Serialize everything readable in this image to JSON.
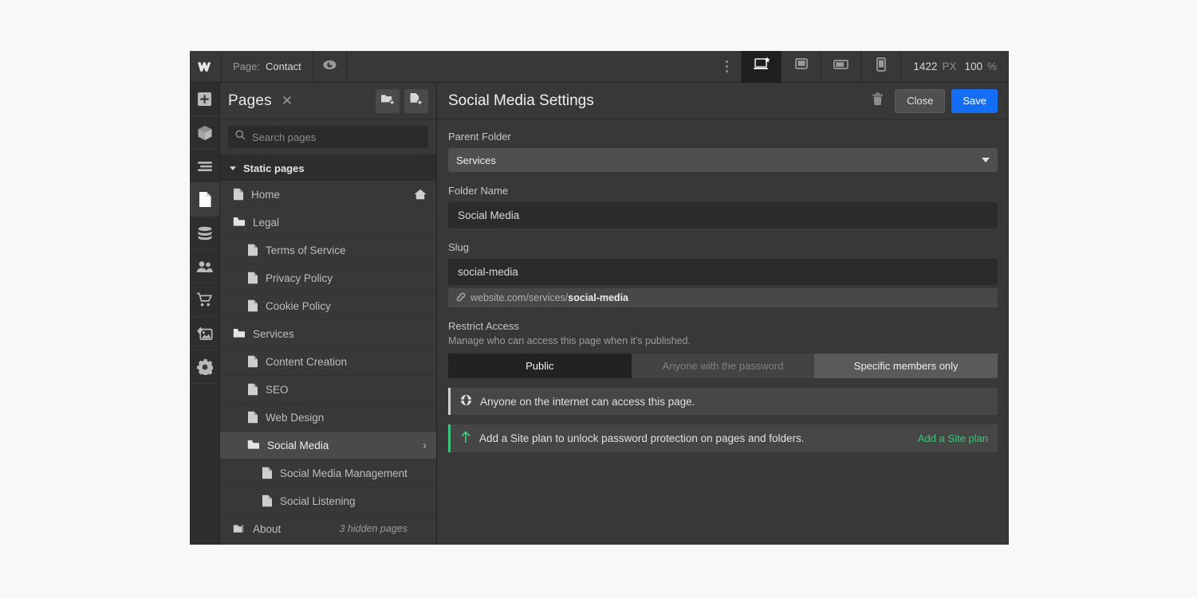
{
  "topbar": {
    "logo_icon": "webflow-logo-icon",
    "page_prefix": "Page:",
    "page_name": "Contact",
    "preview_icon": "eye-preview-icon",
    "kebab_icon": "more-options-icon",
    "viewports": [
      {
        "name": "desktop",
        "icon": "desktop-viewport-icon",
        "active": true
      },
      {
        "name": "tablet",
        "icon": "tablet-viewport-icon",
        "active": false
      },
      {
        "name": "mobile-landscape",
        "icon": "mobile-landscape-viewport-icon",
        "active": false
      },
      {
        "name": "mobile-portrait",
        "icon": "mobile-portrait-viewport-icon",
        "active": false
      }
    ],
    "canvas_width": "1422",
    "canvas_width_unit": "PX",
    "zoom_value": "100",
    "zoom_unit": "%"
  },
  "rail": {
    "items": [
      {
        "name": "add-elements",
        "icon": "plus-square-icon",
        "active": false
      },
      {
        "name": "components",
        "icon": "cube-icon",
        "active": false
      },
      {
        "name": "navigator",
        "icon": "layers-icon",
        "active": false
      },
      {
        "name": "pages",
        "icon": "page-icon",
        "active": true
      },
      {
        "name": "cms",
        "icon": "database-icon",
        "active": false
      },
      {
        "name": "users",
        "icon": "users-icon",
        "active": false
      },
      {
        "name": "ecommerce",
        "icon": "shopping-cart-icon",
        "active": false
      },
      {
        "name": "assets",
        "icon": "images-icon",
        "active": false
      },
      {
        "name": "settings",
        "icon": "gear-icon",
        "active": false
      }
    ]
  },
  "pages_panel": {
    "title": "Pages",
    "close_icon": "close-icon",
    "new_folder_icon": "new-folder-icon",
    "new_page_icon": "new-page-icon",
    "search_placeholder": "Search pages",
    "search_value": "",
    "search_icon": "search-icon",
    "section_label": "Static pages",
    "rows": [
      {
        "label": "Home",
        "icon": "page-icon",
        "level": 1,
        "selected": false,
        "trailing": "home-icon"
      },
      {
        "label": "Legal",
        "icon": "folder-icon",
        "level": 1,
        "selected": false,
        "trailing": ""
      },
      {
        "label": "Terms of Service",
        "icon": "page-icon",
        "level": 2,
        "selected": false,
        "trailing": ""
      },
      {
        "label": "Privacy Policy",
        "icon": "page-icon",
        "level": 2,
        "selected": false,
        "trailing": ""
      },
      {
        "label": "Cookie Policy",
        "icon": "page-icon",
        "level": 2,
        "selected": false,
        "trailing": ""
      },
      {
        "label": "Services",
        "icon": "folder-icon",
        "level": 1,
        "selected": false,
        "trailing": ""
      },
      {
        "label": "Content Creation",
        "icon": "page-icon",
        "level": 2,
        "selected": false,
        "trailing": ""
      },
      {
        "label": "SEO",
        "icon": "page-icon",
        "level": 2,
        "selected": false,
        "trailing": ""
      },
      {
        "label": "Web Design",
        "icon": "page-icon",
        "level": 2,
        "selected": false,
        "trailing": ""
      },
      {
        "label": "Social Media",
        "icon": "folder-icon",
        "level": 2,
        "selected": true,
        "trailing": "chevron-right-icon"
      },
      {
        "label": "Social Media Management",
        "icon": "page-icon",
        "level": 3,
        "selected": false,
        "trailing": ""
      },
      {
        "label": "Social Listening",
        "icon": "page-icon",
        "level": 3,
        "selected": false,
        "trailing": ""
      },
      {
        "label": "About",
        "icon": "hidden-folder-icon",
        "level": 1,
        "selected": false,
        "trailing": "",
        "note": "3 hidden pages"
      }
    ]
  },
  "settings": {
    "title": "Social Media Settings",
    "delete_icon": "trash-icon",
    "close_label": "Close",
    "save_label": "Save",
    "save_color": "#146ef5",
    "parent_folder_label": "Parent Folder",
    "parent_folder_value": "Services",
    "parent_folder_options": [
      "Services"
    ],
    "folder_name_label": "Folder Name",
    "folder_name_value": "Social Media",
    "slug_label": "Slug",
    "slug_value": "social-media",
    "url_icon": "link-icon",
    "url_base": "website.com/services/",
    "url_slug": "social-media",
    "restrict_label": "Restrict Access",
    "restrict_sub": "Manage who can access this page when it's published.",
    "access_options": [
      {
        "label": "Public",
        "state": "selected"
      },
      {
        "label": "Anyone with the password",
        "state": "disabled"
      },
      {
        "label": "Specific members only",
        "state": "normal"
      }
    ],
    "notice_public_icon": "globe-icon",
    "notice_public": "Anyone on the internet can access this page.",
    "notice_plan_icon": "arrow-up-icon",
    "notice_plan": "Add a Site plan to unlock password protection on pages and folders.",
    "notice_plan_link": "Add a Site plan",
    "accent_green": "#3ec47a"
  }
}
